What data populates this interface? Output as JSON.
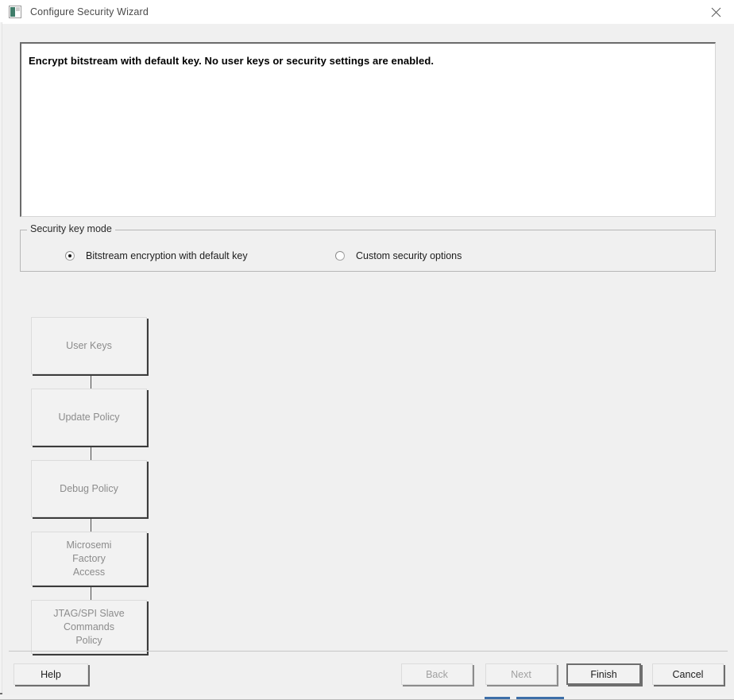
{
  "window": {
    "title": "Configure Security Wizard",
    "icon": "security-wizard-app-icon",
    "close_icon": "close-icon"
  },
  "description": {
    "text": "Encrypt bitstream with default key. No user keys or security settings are enabled."
  },
  "security_key_mode": {
    "legend": "Security key mode",
    "options": [
      {
        "label": "Bitstream encryption with default key",
        "selected": true
      },
      {
        "label": "Custom security options",
        "selected": false
      }
    ]
  },
  "flowchart": {
    "nodes": [
      {
        "label": "User Keys",
        "enabled": false,
        "height": 72
      },
      {
        "label": "Update Policy",
        "enabled": false,
        "height": 72
      },
      {
        "label": "Debug Policy",
        "enabled": false,
        "height": 72
      },
      {
        "label": "Microsemi\nFactory\nAccess",
        "enabled": false,
        "height": 68
      },
      {
        "label": "JTAG/SPI Slave\nCommands\nPolicy",
        "enabled": false,
        "height": 68
      }
    ]
  },
  "footer": {
    "help_label": "Help",
    "back_label": "Back",
    "next_label": "Next",
    "finish_label": "Finish",
    "cancel_label": "Cancel"
  },
  "colors": {
    "dialog_background": "#f0f0f0",
    "panel_background": "#ffffff",
    "titlebar_background": "#ffffff",
    "disabled_text": "#8c8c8c",
    "accent": "#3d6ea8",
    "icon_green": "#3f7d6a"
  }
}
